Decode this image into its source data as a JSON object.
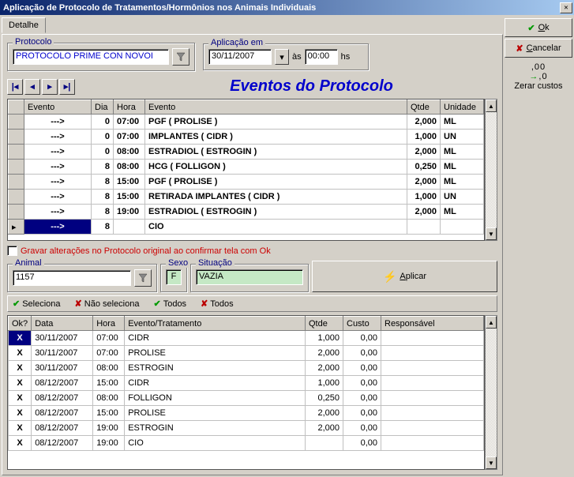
{
  "window": {
    "title": "Aplicação de Protocolo de Tratamentos/Hormônios nos Animais Individuais"
  },
  "tabs": {
    "detalhe": "Detalhe"
  },
  "protocolo_box": {
    "legend": "Protocolo",
    "value": "PROTOCOLO PRIME CON NOVOI"
  },
  "aplicacao_box": {
    "legend": "Aplicação em",
    "date": "30/11/2007",
    "as": "às",
    "time": "00:00",
    "hs": "hs"
  },
  "section_title": "Eventos do Protocolo",
  "events_grid": {
    "headers": {
      "evento_arrow": "Evento",
      "dia": "Dia",
      "hora": "Hora",
      "evento": "Evento",
      "qtde": "Qtde",
      "unidade": "Unidade"
    },
    "rows": [
      {
        "arrow": "--->",
        "dia": "0",
        "hora": "07:00",
        "evento": "PGF ( PROLISE )",
        "qtde": "2,000",
        "un": "ML"
      },
      {
        "arrow": "--->",
        "dia": "0",
        "hora": "07:00",
        "evento": "IMPLANTES ( CIDR )",
        "qtde": "1,000",
        "un": "UN"
      },
      {
        "arrow": "--->",
        "dia": "0",
        "hora": "08:00",
        "evento": "ESTRADIOL ( ESTROGIN )",
        "qtde": "2,000",
        "un": "ML"
      },
      {
        "arrow": "--->",
        "dia": "8",
        "hora": "08:00",
        "evento": "HCG ( FOLLIGON )",
        "qtde": "0,250",
        "un": "ML"
      },
      {
        "arrow": "--->",
        "dia": "8",
        "hora": "15:00",
        "evento": "PGF ( PROLISE )",
        "qtde": "2,000",
        "un": "ML"
      },
      {
        "arrow": "--->",
        "dia": "8",
        "hora": "15:00",
        "evento": "RETIRADA IMPLANTES ( CIDR )",
        "qtde": "1,000",
        "un": "UN"
      },
      {
        "arrow": "--->",
        "dia": "8",
        "hora": "19:00",
        "evento": "ESTRADIOL ( ESTROGIN )",
        "qtde": "2,000",
        "un": "ML"
      },
      {
        "arrow": "--->",
        "dia": "8",
        "hora": "",
        "evento": "CIO",
        "qtde": "",
        "un": "",
        "selected": true
      }
    ]
  },
  "gravar_checkbox": "Gravar alterações no Protocolo original ao confirmar tela com Ok",
  "animal_box": {
    "legend": "Animal",
    "value": "1157"
  },
  "sexo_box": {
    "legend": "Sexo",
    "value": "F"
  },
  "situacao_box": {
    "legend": "Situação",
    "value": "VAZIA"
  },
  "aplicar_btn": "Aplicar",
  "toolbar": {
    "seleciona": "Seleciona",
    "nao_seleciona": "Não seleciona",
    "todos1": "Todos",
    "todos2": "Todos"
  },
  "apply_grid": {
    "headers": {
      "ok": "Ok?",
      "data": "Data",
      "hora": "Hora",
      "evt": "Evento/Tratamento",
      "qtde": "Qtde",
      "custo": "Custo",
      "resp": "Responsável"
    },
    "rows": [
      {
        "ok": "X",
        "data": "30/11/2007",
        "hora": "07:00",
        "evt": "CIDR",
        "qtde": "1,000",
        "custo": "0,00",
        "sel": true
      },
      {
        "ok": "X",
        "data": "30/11/2007",
        "hora": "07:00",
        "evt": "PROLISE",
        "qtde": "2,000",
        "custo": "0,00"
      },
      {
        "ok": "X",
        "data": "30/11/2007",
        "hora": "08:00",
        "evt": "ESTROGIN",
        "qtde": "2,000",
        "custo": "0,00"
      },
      {
        "ok": "X",
        "data": "08/12/2007",
        "hora": "15:00",
        "evt": "CIDR",
        "qtde": "1,000",
        "custo": "0,00"
      },
      {
        "ok": "X",
        "data": "08/12/2007",
        "hora": "08:00",
        "evt": "FOLLIGON",
        "qtde": "0,250",
        "custo": "0,00"
      },
      {
        "ok": "X",
        "data": "08/12/2007",
        "hora": "15:00",
        "evt": "PROLISE",
        "qtde": "2,000",
        "custo": "0,00"
      },
      {
        "ok": "X",
        "data": "08/12/2007",
        "hora": "19:00",
        "evt": "ESTROGIN",
        "qtde": "2,000",
        "custo": "0,00"
      },
      {
        "ok": "X",
        "data": "08/12/2007",
        "hora": "19:00",
        "evt": "CIO",
        "qtde": "",
        "custo": "0,00"
      }
    ]
  },
  "right": {
    "ok": "Ok",
    "cancel": "Cancelar",
    "zerar_dots": ",00",
    "zerar_sub": ",0",
    "zerar_label": "Zerar custos"
  }
}
